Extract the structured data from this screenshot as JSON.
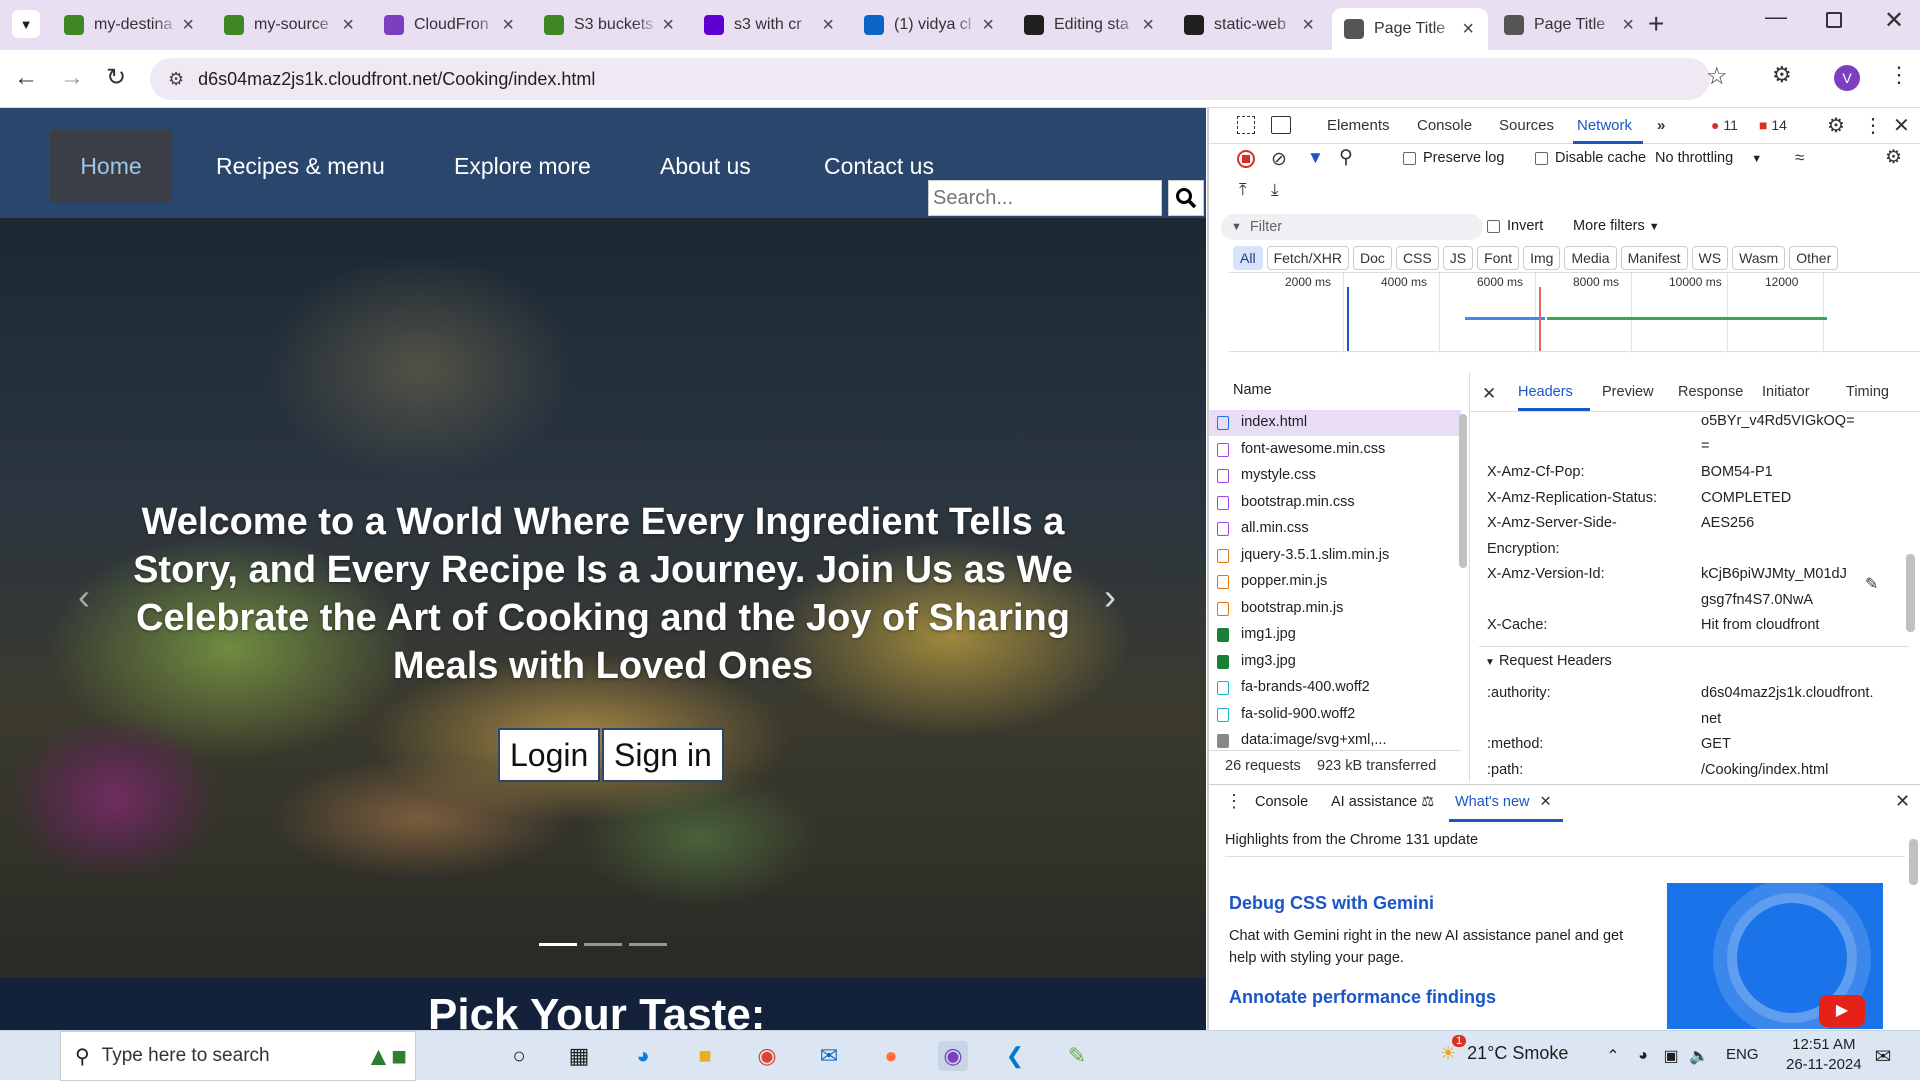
{
  "browser": {
    "tabs": [
      {
        "title": "my-destina",
        "icon": "s3-bucket-icon",
        "color": "#3f8624",
        "active": false
      },
      {
        "title": "my-source",
        "icon": "s3-bucket-icon",
        "color": "#3f8624",
        "active": false
      },
      {
        "title": "CloudFron",
        "icon": "cloudfront-icon",
        "color": "#7b3fbf",
        "active": false
      },
      {
        "title": "S3 buckets",
        "icon": "s3-bucket-icon",
        "color": "#3f8624",
        "active": false
      },
      {
        "title": "s3 with cr",
        "icon": "yahoo-icon",
        "color": "#6001d2",
        "active": false
      },
      {
        "title": "(1) vidya cl",
        "icon": "linkedin-icon",
        "color": "#0a66c2",
        "active": false
      },
      {
        "title": "Editing sta",
        "icon": "github-icon",
        "color": "#1f1f1f",
        "active": false
      },
      {
        "title": "static-web",
        "icon": "github-icon",
        "color": "#1f1f1f",
        "active": false
      },
      {
        "title": "Page Title",
        "icon": "globe-icon",
        "color": "#555555",
        "active": true
      },
      {
        "title": "Page Title",
        "icon": "globe-icon",
        "color": "#555555",
        "active": false
      }
    ],
    "url": "d6s04maz2js1k.cloudfront.net/Cooking/index.html",
    "profile_initial": "V"
  },
  "site": {
    "nav": [
      "Home",
      "Recipes & menu",
      "Explore more",
      "About us",
      "Contact us"
    ],
    "search_placeholder": "Search...",
    "hero_text": "Welcome to a World Where Every Ingredient Tells a Story, and Every Recipe Is a Journey. Join Us as We Celebrate the Art of Cooking and the Joy of Sharing Meals with Loved Ones",
    "login": "Login",
    "signin": "Sign in",
    "next_heading": "Pick Your Taste:"
  },
  "devtools": {
    "tabs": [
      "Elements",
      "Console",
      "Sources",
      "Network"
    ],
    "errors": "11",
    "warnings": "14",
    "preserve_log": "Preserve log",
    "disable_cache": "Disable cache",
    "throttling": "No throttling",
    "filter_placeholder": "Filter",
    "invert": "Invert",
    "more_filters": "More filters",
    "type_filters": [
      "All",
      "Fetch/XHR",
      "Doc",
      "CSS",
      "JS",
      "Font",
      "Img",
      "Media",
      "Manifest",
      "WS",
      "Wasm",
      "Other"
    ],
    "timeline_ticks": [
      "2000 ms",
      "4000 ms",
      "6000 ms",
      "8000 ms",
      "10000 ms",
      "12000"
    ],
    "name_header": "Name",
    "files": [
      {
        "name": "index.html",
        "type": "doc",
        "color": "#1a73e8"
      },
      {
        "name": "font-awesome.min.css",
        "type": "css",
        "color": "#a142f4"
      },
      {
        "name": "mystyle.css",
        "type": "css",
        "color": "#a142f4"
      },
      {
        "name": "bootstrap.min.css",
        "type": "css",
        "color": "#a142f4"
      },
      {
        "name": "all.min.css",
        "type": "css",
        "color": "#a142f4"
      },
      {
        "name": "jquery-3.5.1.slim.min.js",
        "type": "js",
        "color": "#e8710a"
      },
      {
        "name": "popper.min.js",
        "type": "js",
        "color": "#e8710a"
      },
      {
        "name": "bootstrap.min.js",
        "type": "js",
        "color": "#e8710a"
      },
      {
        "name": "img1.jpg",
        "type": "img",
        "color": "#188038"
      },
      {
        "name": "img3.jpg",
        "type": "img",
        "color": "#188038"
      },
      {
        "name": "fa-brands-400.woff2",
        "type": "font",
        "color": "#12b5cb"
      },
      {
        "name": "fa-solid-900.woff2",
        "type": "font",
        "color": "#12b5cb"
      },
      {
        "name": "data:image/svg+xml,...",
        "type": "img",
        "color": "#888888"
      }
    ],
    "summary_requests": "26 requests",
    "summary_transferred": "923 kB transferred",
    "detail_tabs": [
      "Headers",
      "Preview",
      "Response",
      "Initiator",
      "Timing"
    ],
    "headers_top_value": "o5BYr_v4Rd5VIGkOQ=",
    "headers_top_value2": "=",
    "response_headers": [
      {
        "k": "X-Amz-Cf-Pop:",
        "v": "BOM54-P1"
      },
      {
        "k": "X-Amz-Replication-Status:",
        "v": "COMPLETED"
      },
      {
        "k": "X-Amz-Server-Side-",
        "v": "AES256"
      },
      {
        "k": "Encryption:",
        "v": ""
      },
      {
        "k": "X-Amz-Version-Id:",
        "v": "kCjB6piWJMty_M01dJ"
      },
      {
        "k": "",
        "v": "gsg7fn4S7.0NwA"
      },
      {
        "k": "X-Cache:",
        "v": "Hit from cloudfront"
      }
    ],
    "request_headers_title": "Request Headers",
    "request_headers": [
      {
        "k": ":authority:",
        "v": "d6s04maz2js1k.cloudfront."
      },
      {
        "k": "",
        "v": "net"
      },
      {
        "k": ":method:",
        "v": "GET"
      },
      {
        "k": ":path:",
        "v": "/Cooking/index.html"
      }
    ],
    "drawer_tabs": [
      "Console",
      "AI assistance",
      "What's new"
    ],
    "whats_new_title": "Highlights from the Chrome 131 update",
    "whats_new_h1": "Debug CSS with Gemini",
    "whats_new_p1": "Chat with Gemini right in the new AI assistance panel and get help with styling your page.",
    "whats_new_h2": "Annotate performance findings"
  },
  "taskbar": {
    "search_placeholder": "Type here to search",
    "weather": "21°C  Smoke",
    "weather_badge": "1",
    "lang": "ENG",
    "time": "12:51 AM",
    "date": "26-11-2024"
  }
}
